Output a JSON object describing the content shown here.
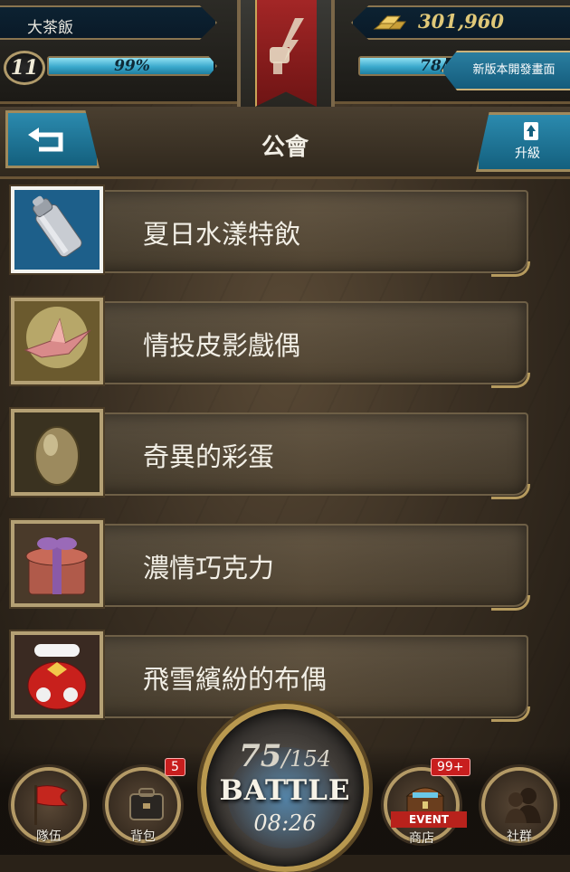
{
  "player": {
    "name": "大茶飯",
    "level": "11",
    "exp_percent": "99%",
    "exp_fraction": 0.99,
    "stamina_text": "78/",
    "stamina_fraction": 0.9
  },
  "currency": {
    "gold": "301,960",
    "icon": "gold-bars-icon"
  },
  "header": {
    "update_button_label": "新版本開發畫面",
    "title": "公會",
    "back_icon": "back-arrow-icon",
    "upgrade_label": "升級",
    "upgrade_icon": "upgrade-arrow-icon"
  },
  "items": [
    {
      "label": "夏日水漾特飲",
      "icon": "cocktail-shaker-icon",
      "selected": true
    },
    {
      "label": "情投皮影戲偶",
      "icon": "paper-crane-icon",
      "selected": false
    },
    {
      "label": "奇異的彩蛋",
      "icon": "golden-egg-icon",
      "selected": false
    },
    {
      "label": "濃情巧克力",
      "icon": "gift-box-icon",
      "selected": false
    },
    {
      "label": "飛雪繽紛的布偶",
      "icon": "santa-sack-icon",
      "selected": false
    }
  ],
  "nav": {
    "team": {
      "label": "隊伍",
      "icon": "flag-icon"
    },
    "bag": {
      "label": "背包",
      "icon": "bag-icon",
      "badge": "5"
    },
    "battle": {
      "stamina_current": "75",
      "stamina_max": "154",
      "label": "BATTLE",
      "timer": "08:26"
    },
    "shop": {
      "label": "商店",
      "icon": "treasure-chest-icon",
      "badge": "99+",
      "ribbon": "EVENT"
    },
    "social": {
      "label": "社群",
      "icon": "people-silhouette-icon"
    }
  },
  "colors": {
    "accent_blue": "#2b8aae",
    "gold_trim": "#b4a074",
    "badge_red": "#c81e1e"
  }
}
